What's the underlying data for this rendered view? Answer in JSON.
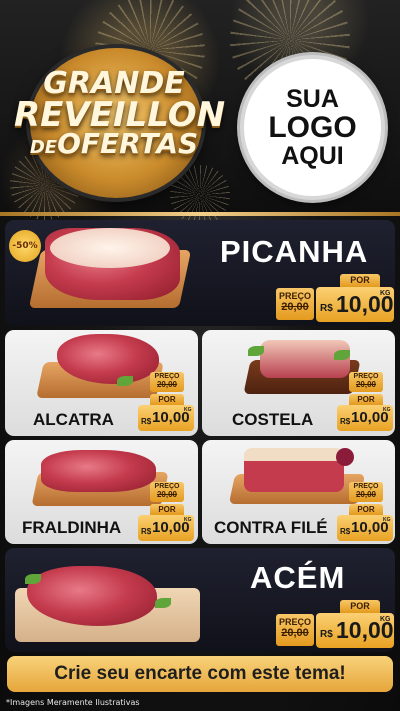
{
  "header": {
    "emblem": {
      "line1": "GRANDE",
      "line2": "REVEILLON",
      "line3_prefix": "DE",
      "line3": "OFERTAS"
    },
    "logo": {
      "line1": "SUA",
      "line2": "LOGO",
      "line3": "AQUI"
    }
  },
  "products": [
    {
      "name": "PICANHA",
      "discount_badge": "-50%",
      "old_label": "PREÇO",
      "old_price": "20,00",
      "new_label": "POR",
      "currency": "R$",
      "price": "10,00",
      "unit": "KG"
    },
    {
      "name": "ALCATRA",
      "old_label": "PREÇO",
      "old_price": "20,00",
      "new_label": "POR",
      "currency": "R$",
      "price": "10,00",
      "unit": "KG"
    },
    {
      "name": "COSTELA",
      "old_label": "PREÇO",
      "old_price": "20,00",
      "new_label": "POR",
      "currency": "R$",
      "price": "10,00",
      "unit": "KG"
    },
    {
      "name": "FRALDINHA",
      "old_label": "PREÇO",
      "old_price": "20,00",
      "new_label": "POR",
      "currency": "R$",
      "price": "10,00",
      "unit": "KG"
    },
    {
      "name": "CONTRA FILÉ",
      "old_label": "PREÇO",
      "old_price": "20,00",
      "new_label": "POR",
      "currency": "R$",
      "price": "10,00",
      "unit": "KG"
    },
    {
      "name": "ACÉM",
      "old_label": "PREÇO",
      "old_price": "20,00",
      "new_label": "POR",
      "currency": "R$",
      "price": "10,00",
      "unit": "KG"
    }
  ],
  "cta": {
    "label": "Crie seu encarte com este tema!"
  },
  "footnote": "*Imagens Meramente Ilustrativas",
  "colors": {
    "gold": "#e8a223",
    "dark_card": "#15161f",
    "light_card": "#e8e8e8",
    "meat": "#c43b4d"
  }
}
